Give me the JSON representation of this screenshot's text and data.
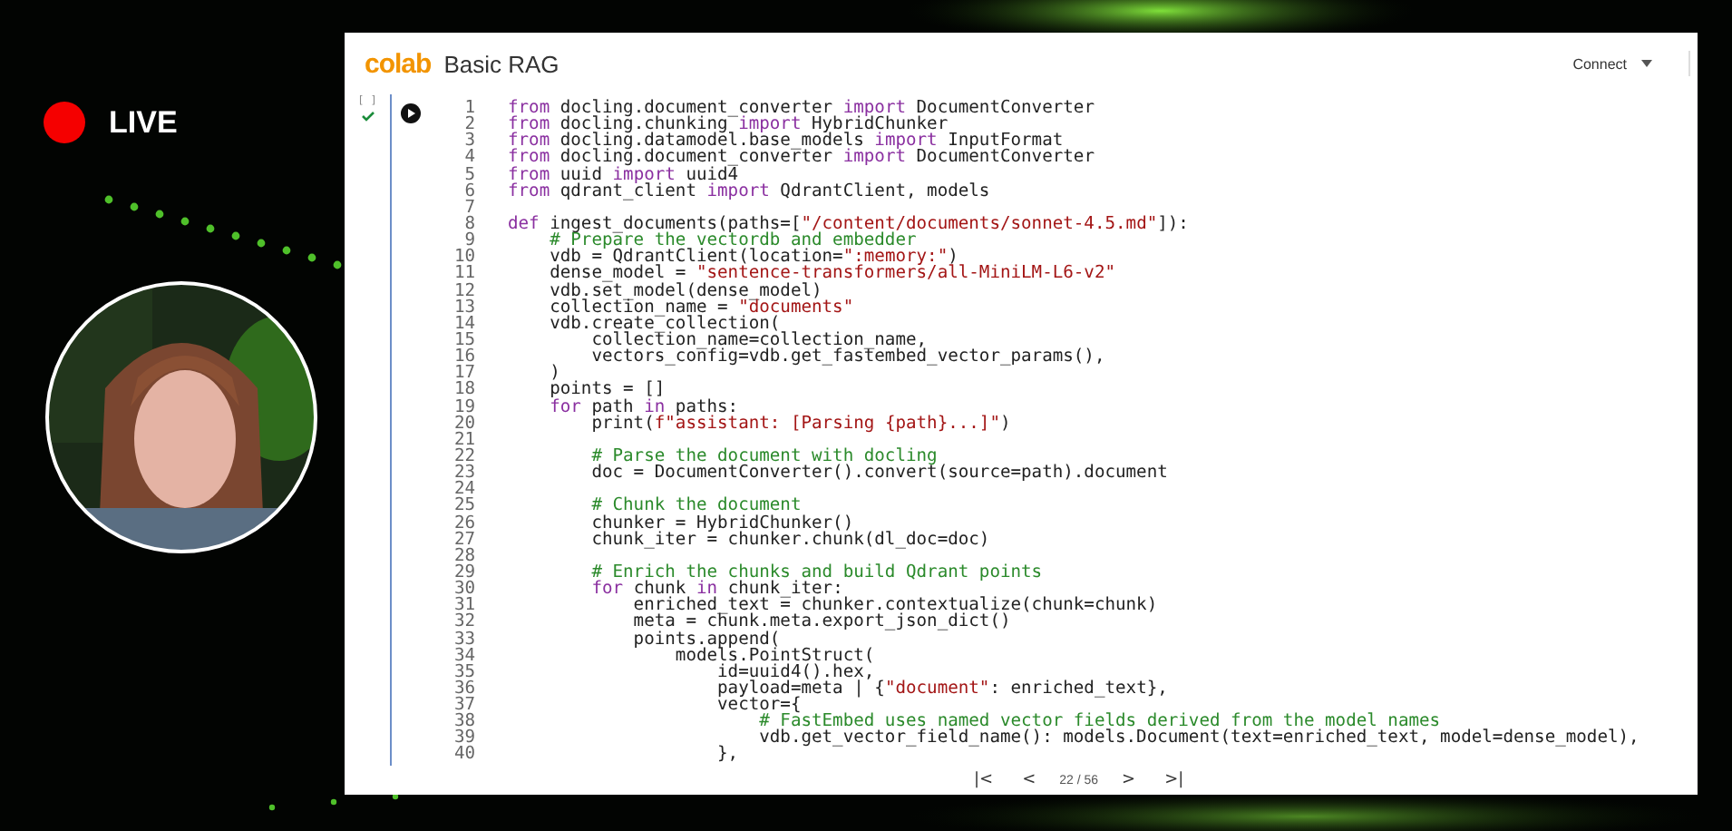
{
  "live": {
    "label": "LIVE"
  },
  "notebook": {
    "logo": "colab",
    "title": "Basic RAG",
    "connect": "Connect",
    "cell": {
      "bracket": "[ ]",
      "done": true,
      "lines": [
        {
          "n": "1",
          "segs": [
            {
              "kind": "keyword",
              "text": "from"
            },
            {
              "kind": "plain",
              "text": " docling.document_converter "
            },
            {
              "kind": "keyword",
              "text": "import"
            },
            {
              "kind": "plain",
              "text": " DocumentConverter"
            }
          ]
        },
        {
          "n": "2",
          "segs": [
            {
              "kind": "keyword",
              "text": "from"
            },
            {
              "kind": "plain",
              "text": " docling.chunking "
            },
            {
              "kind": "keyword",
              "text": "import"
            },
            {
              "kind": "plain",
              "text": " HybridChunker"
            }
          ]
        },
        {
          "n": "3",
          "segs": [
            {
              "kind": "keyword",
              "text": "from"
            },
            {
              "kind": "plain",
              "text": " docling.datamodel.base_models "
            },
            {
              "kind": "keyword",
              "text": "import"
            },
            {
              "kind": "plain",
              "text": " InputFormat"
            }
          ]
        },
        {
          "n": "4",
          "segs": [
            {
              "kind": "keyword",
              "text": "from"
            },
            {
              "kind": "plain",
              "text": " docling.document_converter "
            },
            {
              "kind": "keyword",
              "text": "import"
            },
            {
              "kind": "plain",
              "text": " DocumentConverter"
            }
          ]
        },
        {
          "n": "5",
          "segs": [
            {
              "kind": "keyword",
              "text": "from"
            },
            {
              "kind": "plain",
              "text": " uuid "
            },
            {
              "kind": "keyword",
              "text": "import"
            },
            {
              "kind": "plain",
              "text": " uuid4"
            }
          ]
        },
        {
          "n": "6",
          "segs": [
            {
              "kind": "keyword",
              "text": "from"
            },
            {
              "kind": "plain",
              "text": " qdrant_client "
            },
            {
              "kind": "keyword",
              "text": "import"
            },
            {
              "kind": "plain",
              "text": " QdrantClient, models"
            }
          ]
        },
        {
          "n": "7"
        },
        {
          "n": "8",
          "segs": [
            {
              "kind": "keyword",
              "text": "def"
            },
            {
              "kind": "plain",
              "text": " ingest_documents(paths=["
            },
            {
              "kind": "string",
              "text": "\"/content/documents/sonnet-4.5.md\""
            },
            {
              "kind": "plain",
              "text": "]):"
            }
          ]
        },
        {
          "n": "9",
          "segs": [
            {
              "kind": "comment",
              "text": "    # Prepare the vectordb and embedder"
            }
          ]
        },
        {
          "n": "10",
          "segs": [
            {
              "kind": "plain",
              "text": "    vdb = QdrantClient(location="
            },
            {
              "kind": "string",
              "text": "\":memory:\""
            },
            {
              "kind": "plain",
              "text": ")"
            }
          ]
        },
        {
          "n": "11",
          "segs": [
            {
              "kind": "plain",
              "text": "    dense_model = "
            },
            {
              "kind": "string",
              "text": "\"sentence-transformers/all-MiniLM-L6-v2\""
            }
          ]
        },
        {
          "n": "12",
          "segs": [
            {
              "kind": "plain",
              "text": "    vdb.set_model(dense_model)"
            }
          ]
        },
        {
          "n": "13",
          "segs": [
            {
              "kind": "plain",
              "text": "    collection_name = "
            },
            {
              "kind": "string",
              "text": "\"documents\""
            }
          ]
        },
        {
          "n": "14",
          "segs": [
            {
              "kind": "plain",
              "text": "    vdb.create_collection("
            }
          ]
        },
        {
          "n": "15",
          "segs": [
            {
              "kind": "plain",
              "text": "        collection_name=collection_name,"
            }
          ]
        },
        {
          "n": "16",
          "segs": [
            {
              "kind": "plain",
              "text": "        vectors_config=vdb.get_fastembed_vector_params(),"
            }
          ]
        },
        {
          "n": "17",
          "segs": [
            {
              "kind": "plain",
              "text": "    )"
            }
          ]
        },
        {
          "n": "18",
          "segs": [
            {
              "kind": "plain",
              "text": "    points = []"
            }
          ]
        },
        {
          "n": "19",
          "segs": [
            {
              "kind": "keyword",
              "text": "    for"
            },
            {
              "kind": "plain",
              "text": " path "
            },
            {
              "kind": "keyword",
              "text": "in"
            },
            {
              "kind": "plain",
              "text": " paths:"
            }
          ]
        },
        {
          "n": "20",
          "segs": [
            {
              "kind": "plain",
              "text": "        print("
            },
            {
              "kind": "string",
              "text": "f\"assistant: [Parsing {path}...]\""
            },
            {
              "kind": "plain",
              "text": ")"
            }
          ]
        },
        {
          "n": "21"
        },
        {
          "n": "22",
          "segs": [
            {
              "kind": "comment",
              "text": "        # Parse the document with docling"
            }
          ]
        },
        {
          "n": "23",
          "segs": [
            {
              "kind": "plain",
              "text": "        doc = DocumentConverter().convert(source=path).document"
            }
          ]
        },
        {
          "n": "24"
        },
        {
          "n": "25",
          "segs": [
            {
              "kind": "comment",
              "text": "        # Chunk the document"
            }
          ]
        },
        {
          "n": "26",
          "segs": [
            {
              "kind": "plain",
              "text": "        chunker = HybridChunker()"
            }
          ]
        },
        {
          "n": "27",
          "segs": [
            {
              "kind": "plain",
              "text": "        chunk_iter = chunker.chunk(dl_doc=doc)"
            }
          ]
        },
        {
          "n": "28"
        },
        {
          "n": "29",
          "segs": [
            {
              "kind": "comment",
              "text": "        # Enrich the chunks and build Qdrant points"
            }
          ]
        },
        {
          "n": "30",
          "segs": [
            {
              "kind": "keyword",
              "text": "        for"
            },
            {
              "kind": "plain",
              "text": " chunk "
            },
            {
              "kind": "keyword",
              "text": "in"
            },
            {
              "kind": "plain",
              "text": " chunk_iter:"
            }
          ]
        },
        {
          "n": "31",
          "segs": [
            {
              "kind": "plain",
              "text": "            enriched_text = chunker.contextualize(chunk=chunk)"
            }
          ]
        },
        {
          "n": "32",
          "segs": [
            {
              "kind": "plain",
              "text": "            meta = chunk.meta.export_json_dict()"
            }
          ]
        },
        {
          "n": "33",
          "segs": [
            {
              "kind": "plain",
              "text": "            points.append("
            }
          ]
        },
        {
          "n": "34",
          "segs": [
            {
              "kind": "plain",
              "text": "                models.PointStruct("
            }
          ]
        },
        {
          "n": "35",
          "segs": [
            {
              "kind": "plain",
              "text": "                    id=uuid4().hex,"
            }
          ]
        },
        {
          "n": "36",
          "segs": [
            {
              "kind": "plain",
              "text": "                    payload=meta | {"
            },
            {
              "kind": "string",
              "text": "\"document\""
            },
            {
              "kind": "plain",
              "text": ": enriched_text},"
            }
          ]
        },
        {
          "n": "37",
          "segs": [
            {
              "kind": "plain",
              "text": "                    vector={"
            }
          ]
        },
        {
          "n": "38",
          "segs": [
            {
              "kind": "comment",
              "text": "                        # FastEmbed uses named vector fields derived from the model names"
            }
          ]
        },
        {
          "n": "39",
          "segs": [
            {
              "kind": "plain",
              "text": "                        vdb.get_vector_field_name(): models.Document(text=enriched_text, model=dense_model),"
            }
          ]
        },
        {
          "n": "40",
          "segs": [
            {
              "kind": "plain",
              "text": "                    },"
            }
          ]
        }
      ]
    }
  },
  "pager": {
    "first": "|<",
    "prev": "<",
    "position": "22 / 56",
    "next": ">",
    "last": ">|"
  }
}
